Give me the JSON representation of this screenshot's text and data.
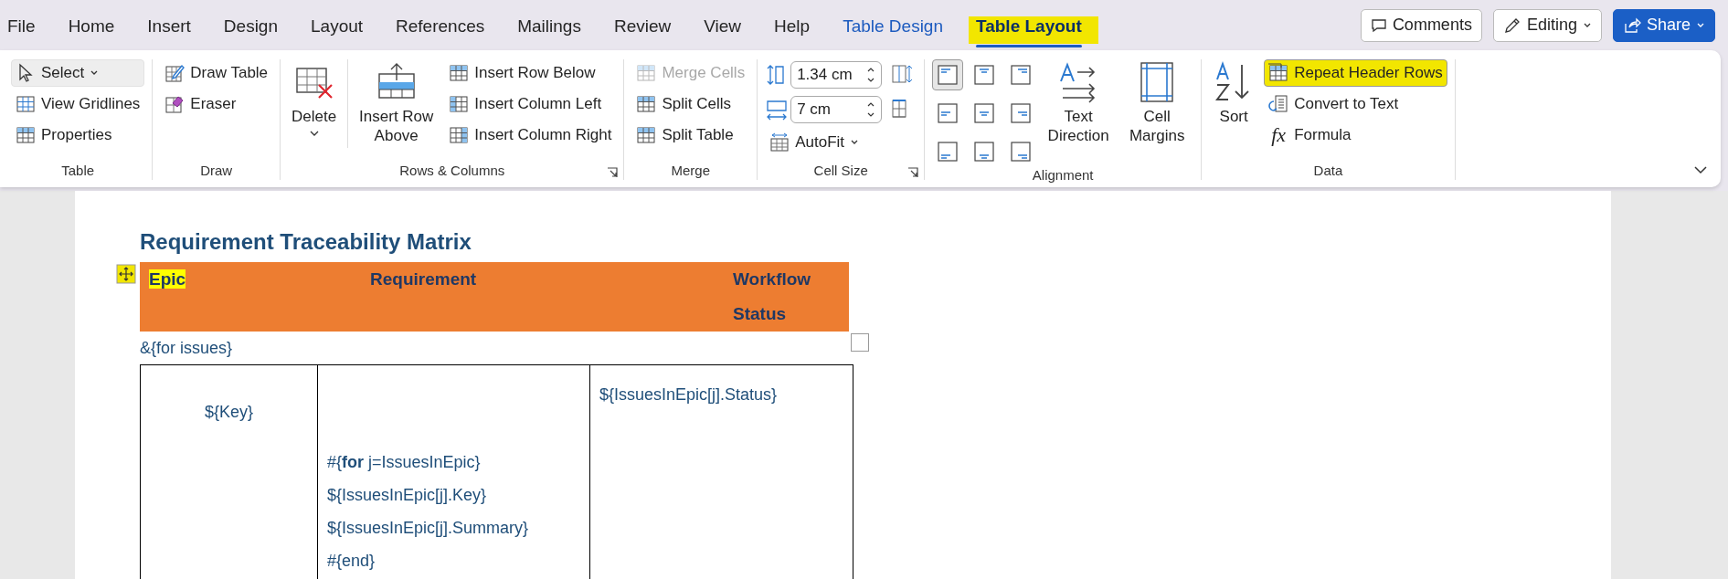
{
  "menu_tabs": [
    {
      "label": "File",
      "kind": "standard",
      "selected": false,
      "highlighted": false
    },
    {
      "label": "Home",
      "kind": "standard",
      "selected": false,
      "highlighted": false
    },
    {
      "label": "Insert",
      "kind": "standard",
      "selected": false,
      "highlighted": false
    },
    {
      "label": "Design",
      "kind": "standard",
      "selected": false,
      "highlighted": false
    },
    {
      "label": "Layout",
      "kind": "standard",
      "selected": false,
      "highlighted": false
    },
    {
      "label": "References",
      "kind": "standard",
      "selected": false,
      "highlighted": false
    },
    {
      "label": "Mailings",
      "kind": "standard",
      "selected": false,
      "highlighted": false
    },
    {
      "label": "Review",
      "kind": "standard",
      "selected": false,
      "highlighted": false
    },
    {
      "label": "View",
      "kind": "standard",
      "selected": false,
      "highlighted": false
    },
    {
      "label": "Help",
      "kind": "standard",
      "selected": false,
      "highlighted": false
    },
    {
      "label": "Table Design",
      "kind": "contextual",
      "selected": false,
      "highlighted": false
    },
    {
      "label": "Table Layout",
      "kind": "contextual",
      "selected": true,
      "highlighted": true
    }
  ],
  "header_buttons": [
    {
      "label": "Comments",
      "kind": "outline"
    },
    {
      "label": "Editing",
      "kind": "dropdown"
    },
    {
      "label": "Share",
      "kind": "primary"
    }
  ],
  "ribbon_groups": [
    {
      "label": "Table",
      "columns": [
        [
          {
            "kind": "small",
            "label": "Select",
            "dropdown": true,
            "selected": true,
            "disabled": false,
            "highlighted": false
          },
          {
            "kind": "small",
            "label": "View Gridlines",
            "dropdown": false,
            "selected": false,
            "disabled": false,
            "highlighted": false
          },
          {
            "kind": "small",
            "label": "Properties",
            "dropdown": false,
            "selected": false,
            "disabled": false,
            "highlighted": false
          }
        ]
      ]
    },
    {
      "label": "Draw",
      "columns": [
        [
          {
            "kind": "small",
            "label": "Draw Table",
            "dropdown": false,
            "selected": false,
            "disabled": false,
            "highlighted": false
          },
          {
            "kind": "small",
            "label": "Eraser",
            "dropdown": false,
            "selected": false,
            "disabled": false,
            "highlighted": false
          }
        ]
      ]
    },
    {
      "label": "Rows & Columns",
      "columns": [
        [
          {
            "kind": "large",
            "label": "Delete",
            "dropdown": true,
            "selected": false,
            "disabled": false
          }
        ],
        [
          {
            "kind": "large",
            "label": "Insert Row Above",
            "dropdown": false,
            "selected": false,
            "disabled": false
          }
        ],
        [
          {
            "kind": "small",
            "label": "Insert Row Below",
            "dropdown": false,
            "selected": false,
            "disabled": false,
            "highlighted": false
          },
          {
            "kind": "small",
            "label": "Insert Column Left",
            "dropdown": false,
            "selected": false,
            "disabled": false,
            "highlighted": false
          },
          {
            "kind": "small",
            "label": "Insert Column Right",
            "dropdown": false,
            "selected": false,
            "disabled": false,
            "highlighted": false
          }
        ]
      ]
    },
    {
      "label": "Merge",
      "columns": [
        [
          {
            "kind": "small",
            "label": "Merge Cells",
            "dropdown": false,
            "selected": false,
            "disabled": true,
            "highlighted": false
          },
          {
            "kind": "small",
            "label": "Split Cells",
            "dropdown": false,
            "selected": false,
            "disabled": false,
            "highlighted": false
          },
          {
            "kind": "small",
            "label": "Split Table",
            "dropdown": false,
            "selected": false,
            "disabled": false,
            "highlighted": false
          }
        ]
      ]
    },
    {
      "label": "Cell Size",
      "columns": [
        [
          {
            "kind": "field",
            "value": "1.34 cm",
            "disabled": false
          },
          {
            "kind": "field",
            "value": "7 cm",
            "disabled": false
          },
          {
            "kind": "small",
            "label": "AutoFit",
            "dropdown": true,
            "selected": false,
            "disabled": false,
            "highlighted": false
          }
        ],
        [
          {
            "kind": "icon",
            "selected": false,
            "disabled": false
          },
          {
            "kind": "icon",
            "selected": false,
            "disabled": false
          }
        ]
      ]
    },
    {
      "label": "Alignment",
      "columns": [
        [
          {
            "kind": "align",
            "selected": true,
            "disabled": false
          },
          {
            "kind": "align",
            "selected": false,
            "disabled": false
          },
          {
            "kind": "align",
            "selected": false,
            "disabled": false
          }
        ],
        [
          {
            "kind": "align",
            "selected": false,
            "disabled": false
          },
          {
            "kind": "align",
            "selected": false,
            "disabled": false
          },
          {
            "kind": "align",
            "selected": false,
            "disabled": false
          }
        ],
        [
          {
            "kind": "align",
            "selected": false,
            "disabled": false
          },
          {
            "kind": "align",
            "selected": false,
            "disabled": false
          },
          {
            "kind": "align",
            "selected": false,
            "disabled": false
          }
        ],
        [
          {
            "kind": "large",
            "label": "Text Direction",
            "dropdown": false,
            "selected": false,
            "disabled": false
          }
        ],
        [
          {
            "kind": "large",
            "label": "Cell Margins",
            "dropdown": false,
            "selected": false,
            "disabled": false
          }
        ]
      ]
    },
    {
      "label": "Data",
      "columns": [
        [
          {
            "kind": "large",
            "label": "Sort",
            "dropdown": false,
            "selected": false,
            "disabled": false
          }
        ],
        [
          {
            "kind": "small",
            "label": "Repeat Header Rows",
            "dropdown": false,
            "selected": true,
            "disabled": false,
            "highlighted": true
          },
          {
            "kind": "small",
            "label": "Convert to Text",
            "dropdown": false,
            "selected": false,
            "disabled": false,
            "highlighted": false
          },
          {
            "kind": "glyph",
            "glyph": "fx",
            "label": "Formula",
            "selected": false,
            "disabled": false
          }
        ]
      ]
    }
  ],
  "document": {
    "title": "Requirement Traceability Matrix",
    "move_handle_highlighted": true,
    "header_row": [
      {
        "text": "Epic",
        "highlighted": true
      },
      {
        "text": "Requirement",
        "highlighted": false
      },
      {
        "text": "Workflow Status",
        "highlighted": false
      }
    ],
    "loop_text": "&{for issues}",
    "body_row": [
      {
        "lines": [
          "${Key}"
        ]
      },
      {
        "lines": [
          "#{**for** j=IssuesInEpic}",
          "${IssuesInEpic[j].Key}",
          "${IssuesInEpic[j].Summary}",
          "#{end}"
        ]
      },
      {
        "lines": [
          "${IssuesInEpic[j].Status}"
        ]
      }
    ]
  }
}
